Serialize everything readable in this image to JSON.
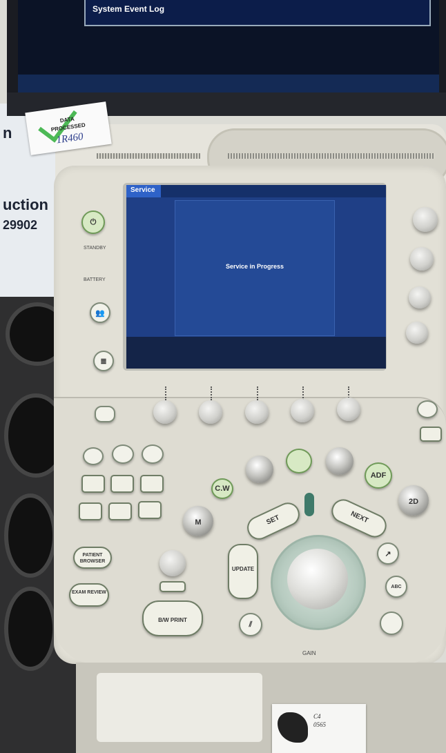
{
  "monitor": {
    "dialog_title": "System Event Log"
  },
  "lcd": {
    "tab_label": "Service",
    "message": "Service in Progress"
  },
  "wall": {
    "line1": "n",
    "line2": "uction",
    "line3": "29902"
  },
  "sticker": {
    "line1": "DATA",
    "line2": "PROCESSED",
    "handwriting": "1R460"
  },
  "power": {
    "standby_label": "STANDBY",
    "battery_label": "BATTERY"
  },
  "buttons": {
    "cw": "C.W",
    "set": "SET",
    "next": "NEXT",
    "update": "UPDATE",
    "adf": "ADF",
    "twod": "2D",
    "m": "M",
    "bw_print": "B/W PRINT",
    "patient_browser": "PATIENT BROWSER",
    "exam_review": "EXAM REVIEW",
    "abc": "ABC",
    "gain": "GAIN"
  },
  "note": {
    "line1": "C4",
    "line2": "0565"
  }
}
